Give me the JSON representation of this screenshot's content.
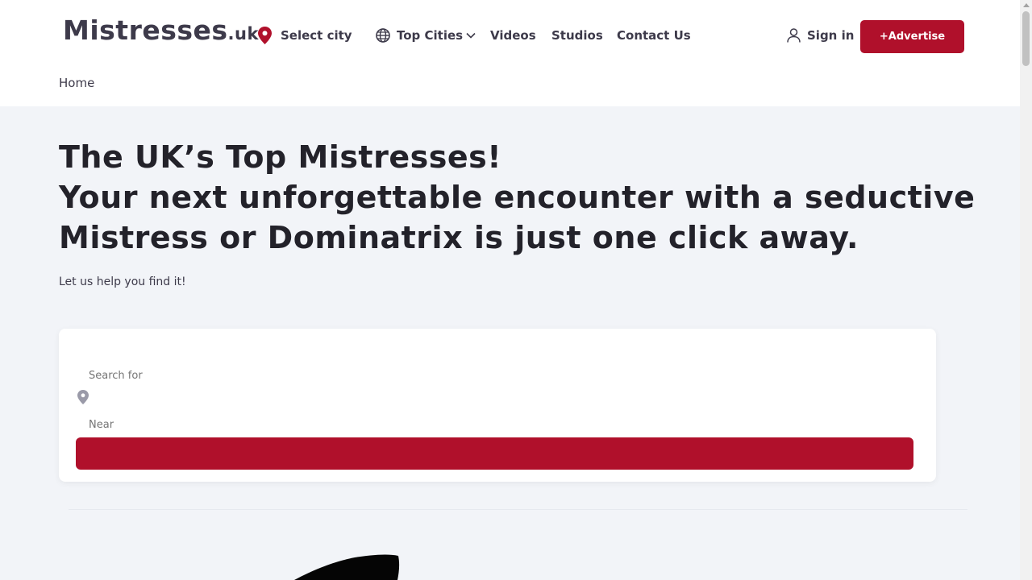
{
  "header": {
    "logo_main": "Mistresses",
    "logo_tld": ".uk",
    "select_city": "Select city",
    "top_cities": "Top Cities",
    "videos": "Videos",
    "studios": "Studios",
    "contact": "Contact Us",
    "sign_in": "Sign in",
    "advertise": "+Advertise"
  },
  "breadcrumb": {
    "home": "Home"
  },
  "hero": {
    "line1": "The UK’s Top Mistresses!",
    "line2": "Your next unforgettable encounter with a seductive",
    "line3": "Mistress or Dominatrix is just one click away.",
    "subtitle": "Let us help you find it!"
  },
  "search": {
    "search_placeholder": "Search for",
    "near_placeholder": "Near"
  },
  "colors": {
    "accent": "#b0102b",
    "text": "#23222a",
    "background": "#f2f4f8"
  },
  "icons": {
    "location": "map-pin-icon",
    "globe": "globe-icon",
    "chevron": "chevron-down-icon",
    "user": "user-icon"
  }
}
